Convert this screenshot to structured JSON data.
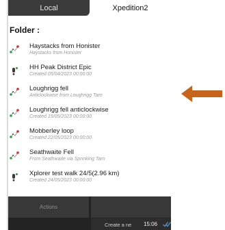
{
  "tabs": {
    "local": "Local",
    "xpedition": "Xpedition2"
  },
  "folder_label": "Folder :",
  "routes": [
    {
      "name": "Haystacks from Honister",
      "sub": "Haystacks from Honister",
      "icon": "route-icon"
    },
    {
      "name": "HH Peak District Epic",
      "sub": "Created 05/04/2023 00:00:00",
      "icon": "waypoint-icon"
    },
    {
      "name": "Loughrigg fell",
      "sub": "Anticlockwise from Loughrigg Tarn",
      "icon": "route-icon"
    },
    {
      "name": "Loughrigg fell anticlockwise",
      "sub": "Created 15/05/2023 00:00:00",
      "icon": "route-icon"
    },
    {
      "name": "Mobberley loop",
      "sub": "Created 22/05/2023 00:00:00",
      "icon": "route-icon"
    },
    {
      "name": "Seathwaite Fell",
      "sub": "From Seathwaite via Sprinking Tarn",
      "icon": "route-icon"
    },
    {
      "name": "Xplorer test walk 24/5(2.96 km)",
      "sub": "Created 24/05/2023 00:00:00",
      "icon": "waypoint-icon"
    }
  ],
  "actions_label": "Actions",
  "create_label": "Create a ne",
  "status": {
    "time": "15:06"
  },
  "colors": {
    "arrow": "#c8631b",
    "route_start": "#2e9e3e",
    "route_end": "#d92b2b",
    "tab_dark": "#3b3b3b",
    "bottom_bar": "#232323"
  }
}
